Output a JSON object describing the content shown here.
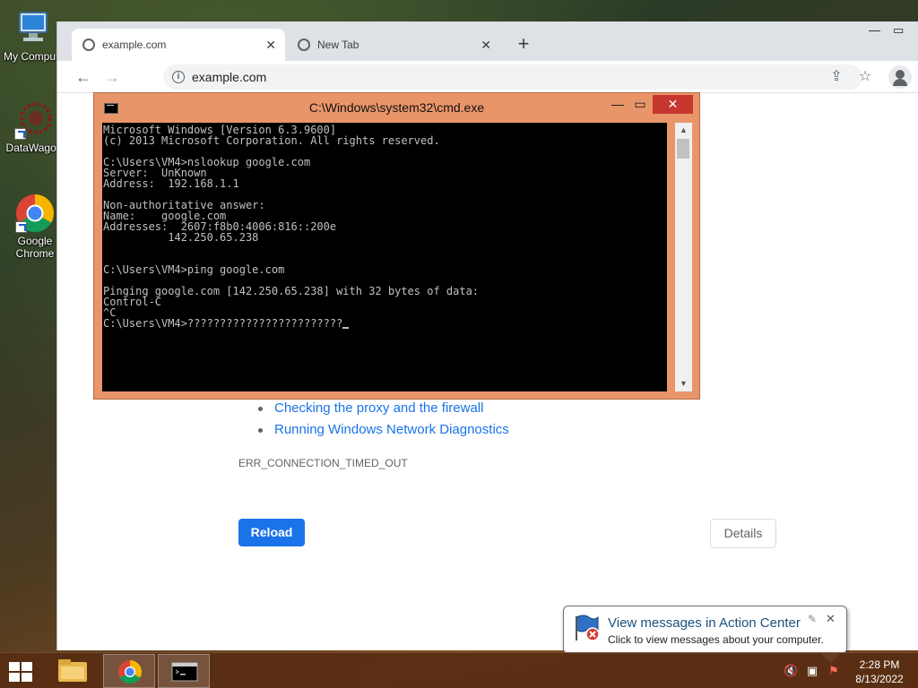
{
  "desktop": {
    "icons": [
      {
        "label": "My Compute"
      },
      {
        "label": "DataWagon"
      },
      {
        "label": "Google Chrome"
      }
    ]
  },
  "browser": {
    "tabs": [
      {
        "title": "example.com",
        "active": true
      },
      {
        "title": "New Tab",
        "active": false
      }
    ],
    "new_tab_symbol": "+",
    "url": "example.com",
    "icons": [
      "back-icon",
      "forward-icon",
      "reload-icon",
      "info-icon",
      "share-icon",
      "star-icon",
      "profile-icon"
    ]
  },
  "error_page": {
    "suggestions": [
      "Checking the proxy and the firewall",
      "Running Windows Network Diagnostics"
    ],
    "error_code": "ERR_CONNECTION_TIMED_OUT",
    "reload_label": "Reload",
    "details_label": "Details",
    "accent_color": "#1a73e8"
  },
  "cmd": {
    "title": "C:\\Windows\\system32\\cmd.exe",
    "lines": [
      "Microsoft Windows [Version 6.3.9600]",
      "(c) 2013 Microsoft Corporation. All rights reserved.",
      "",
      "C:\\Users\\VM4>nslookup google.com",
      "Server:  UnKnown",
      "Address:  192.168.1.1",
      "",
      "Non-authoritative answer:",
      "Name:    google.com",
      "Addresses:  2607:f8b0:4006:816::200e",
      "          142.250.65.238",
      "",
      "",
      "C:\\Users\\VM4>ping google.com",
      "",
      "Pinging google.com [142.250.65.238] with 32 bytes of data:",
      "Control-C",
      "^C",
      "C:\\Users\\VM4>????????????????????????"
    ],
    "titlebar_color": "#e9956a",
    "close_color": "#c7372f"
  },
  "notification": {
    "title": "View messages in Action Center",
    "subtitle": "Click to view messages about your computer."
  },
  "taskbar": {
    "time": "2:28 PM",
    "date": "8/13/2022"
  }
}
